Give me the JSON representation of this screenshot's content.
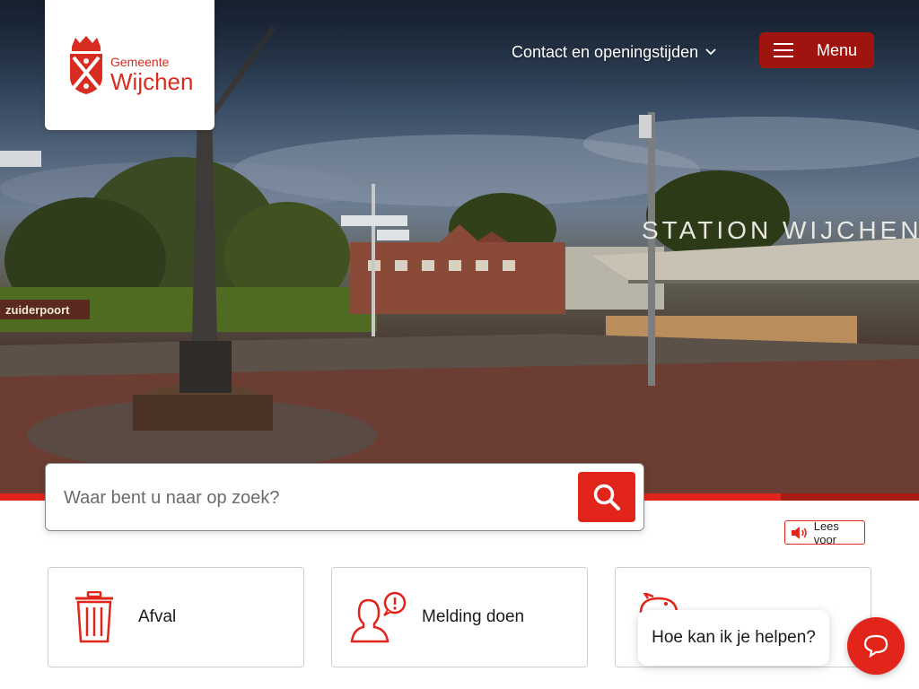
{
  "logo": {
    "line1": "Gemeente",
    "line2": "Wijchen",
    "icon": "coat-of-arms-icon"
  },
  "nav": {
    "contact_label": "Contact en openingstijden",
    "menu_label": "Menu"
  },
  "hero": {
    "sign_station": "STATION WIJCHEN",
    "sign_zuiderpoort": "zuiderpoort"
  },
  "search": {
    "placeholder": "Waar bent u naar op zoek?",
    "icon": "search-icon"
  },
  "read_aloud": {
    "label": "Lees voor",
    "icon": "speaker-icon"
  },
  "tiles": [
    {
      "label": "Afval",
      "icon": "trash-bin-icon"
    },
    {
      "label": "Melding doen",
      "icon": "person-alert-icon"
    },
    {
      "label": "",
      "icon": "piggy-bank-icon"
    }
  ],
  "chat": {
    "bubble_text": "Hoe kan ik je helpen?",
    "icon": "chat-bubble-icon"
  },
  "colors": {
    "brand_red": "#e1251b",
    "dark_red": "#a0140f",
    "logo_red": "#d82c20"
  }
}
